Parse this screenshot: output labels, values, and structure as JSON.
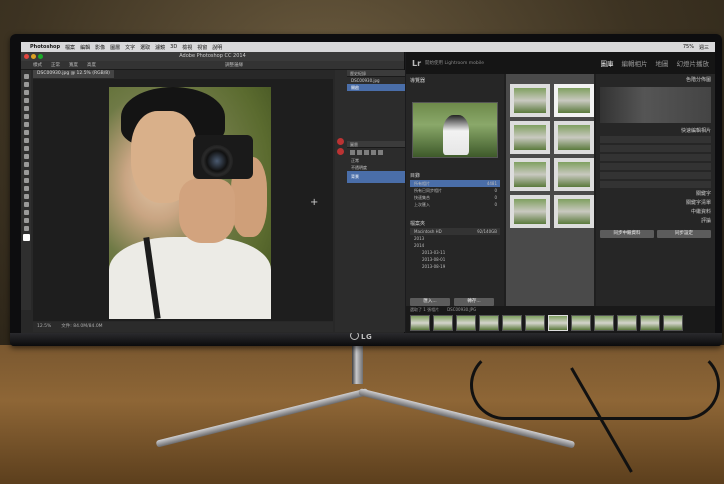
{
  "menubar": {
    "app": "Photoshop",
    "items": [
      "檔案",
      "編輯",
      "影像",
      "圖層",
      "文字",
      "選取",
      "濾鏡",
      "3D",
      "檢視",
      "視窗",
      "說明"
    ],
    "status": [
      "75%",
      "週三"
    ]
  },
  "photoshop": {
    "title": "Adobe Photoshop CC 2014",
    "doc_tab": "DSC00930.jpg @ 12.5% (RGB/8)",
    "options": [
      "樣式",
      "正常",
      "寬度",
      "高度",
      "調整邊緣"
    ],
    "status_zoom": "12.5%",
    "status_doc": "文件: 84.0M/84.0M",
    "panels": {
      "history_title": "歷史紀錄",
      "history_file": "DSC00930.jpg",
      "history_step": "開啟",
      "layers_title": "圖層",
      "layer_name": "背景",
      "blend": "正常",
      "opacity": "不透明度"
    }
  },
  "lightroom": {
    "logo": "Lr",
    "subtitle": "開始使用 Lightroom mobile",
    "modules": [
      {
        "label": "圖庫",
        "active": true
      },
      {
        "label": "編輯相片",
        "active": false
      },
      {
        "label": "地圖",
        "active": false
      },
      {
        "label": "幻燈片播放",
        "active": false
      }
    ],
    "navigator": "導覽器",
    "catalog": "目錄",
    "catalog_items": [
      "所有相片",
      "所有已同步相片",
      "快速集合",
      "上次匯入"
    ],
    "catalog_counts": [
      "4481",
      "0",
      "0",
      "0"
    ],
    "folders": "檔案夾",
    "volume": "Macintosh HD",
    "volume_size": "92/140GB",
    "folder_tree": [
      "2013",
      "2014",
      "2013-03-11",
      "2013-08-01",
      "2013-08-19"
    ],
    "import_btn": "匯入...",
    "export_btn": "轉存...",
    "right": {
      "histogram": "色階分佈圖",
      "quick_develop": "快速編輯相片",
      "keywording": "關鍵字",
      "keyword_list": "關鍵字清單",
      "metadata": "中繼資料",
      "comments": "評論",
      "sync_meta": "同步中繼資料",
      "sync_settings": "同步設定"
    },
    "filmstrip_info": "選取了 1 張相片",
    "filmstrip_file": "DSC00930.JPG"
  }
}
